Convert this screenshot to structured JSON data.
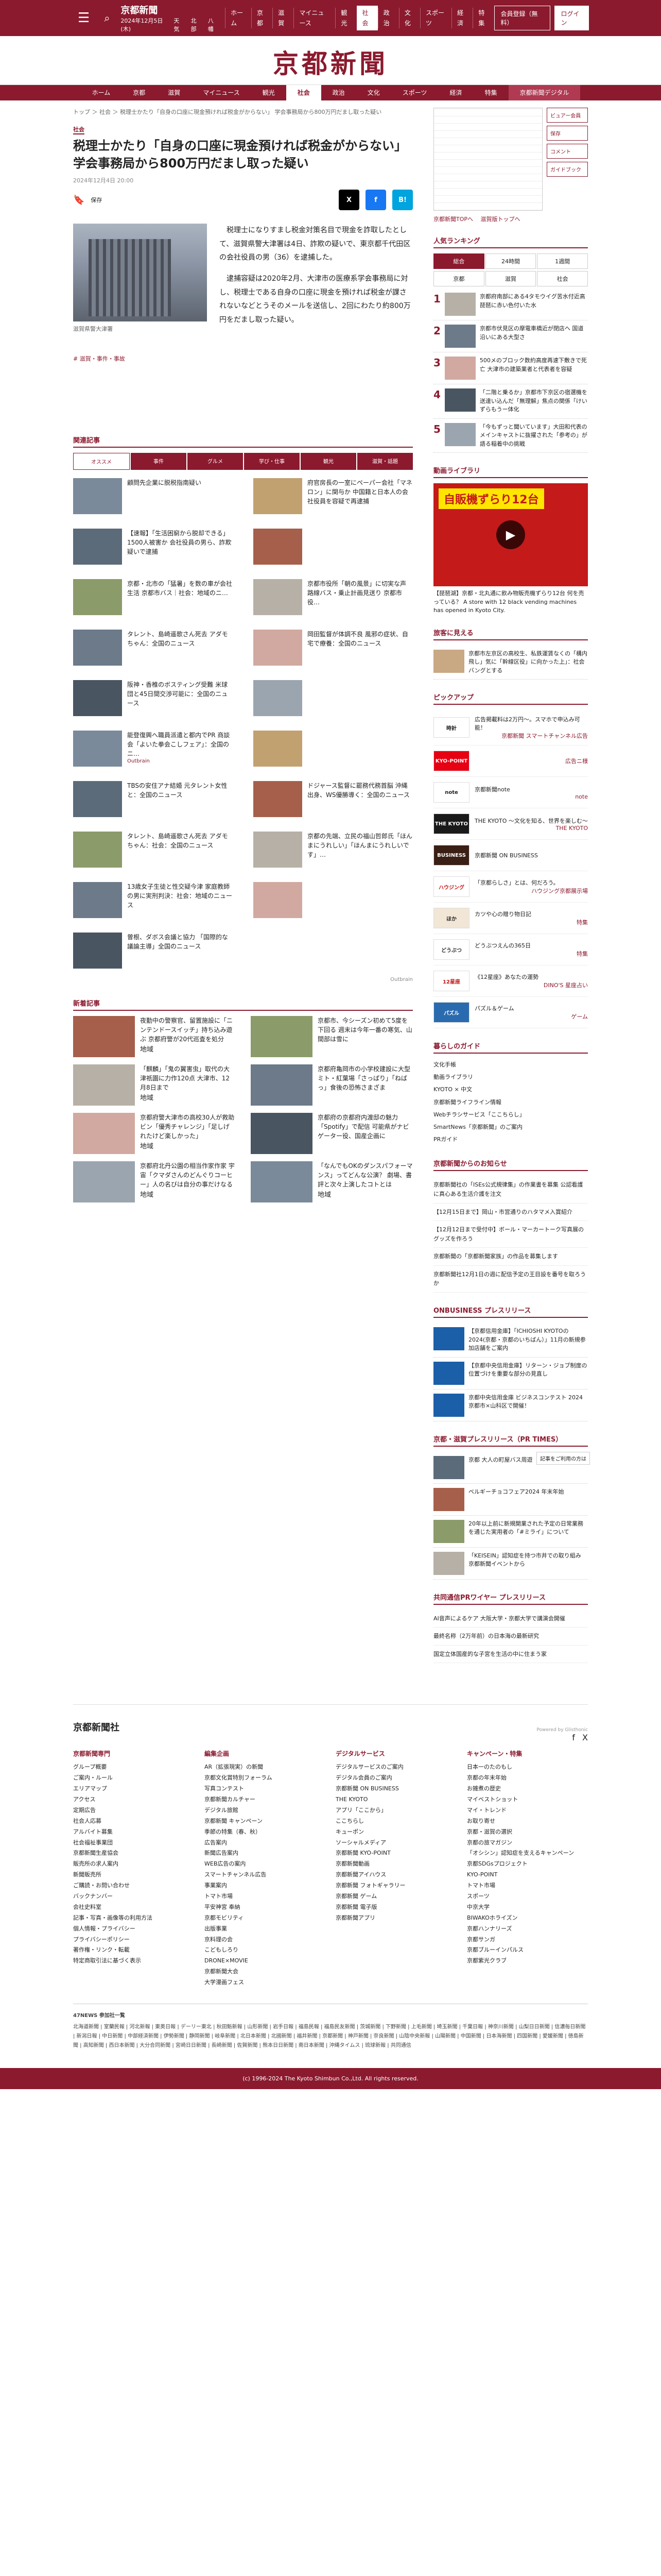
{
  "header": {
    "logo": "京都新聞",
    "nav": [
      "ホーム",
      "京都",
      "滋賀",
      "マイニュース",
      "観光",
      "社会",
      "政治",
      "文化",
      "スポーツ",
      "経済",
      "特集",
      "事件・事故"
    ],
    "nav_active": "社会",
    "date": "2024年12月5日(木)",
    "weather_label": "天気",
    "cities": [
      "北部",
      "八幡"
    ],
    "btn_signup": "会員登録（無料）",
    "btn_login": "ログイン"
  },
  "masthead": "京都新聞",
  "mainnav": [
    "ホーム",
    "京都",
    "滋賀",
    "マイニュース",
    "観光",
    "社会",
    "政治",
    "文化",
    "スポーツ",
    "経済",
    "特集",
    "京都新聞デジタル"
  ],
  "mainnav_active": "社会",
  "breadcrumb": "トップ ＞ 社会 ＞ 税理士かたり「自身の口座に現金預ければ税金がからない」 学会事務局から800万円だまし取った疑い",
  "article": {
    "category": "社会",
    "title": "税理士かたり「自身の口座に現金預ければ税金がからない」 学会事務局から800万円だまし取った疑い",
    "date": "2024年12月4日 20:00",
    "save_label": "保存",
    "photo_caption": "滋賀県警大津署",
    "paragraphs": [
      "税理士になりすまし税金対策名目で現金を詐取したとして、滋賀県警大津署は4日、詐欺の疑いで、東京都千代田区の会社役員の男（36）を逮捕した。",
      "逮捕容疑は2020年2月、大津市の医療系学会事務局に対し、税理士である自身の口座に現金を預ければ税金が課されないなどとうそのメールを送信し、2回にわたり約800万円をだまし取った疑い。"
    ],
    "tags": "# 滋賀・事件・事故"
  },
  "related": {
    "title": "関連記事",
    "tabs": [
      "オススメ",
      "事件",
      "グルメ",
      "学び・仕事",
      "観光",
      "滋賀・話題"
    ],
    "items": [
      {
        "text": "顧問先企業に脱税指南疑い",
        "meta": ""
      },
      {
        "text": "府官房長の一室にペーパー会社「マネロン」に関与か 中国籍と日本人の会社役員を容疑で再逮捕",
        "meta": ""
      },
      {
        "text": "【速報】「生活困窮から脱却できる」1500人被害か 会社役員の男ら、詐欺疑いで逮捕",
        "meta": ""
      },
      {
        "text": "",
        "meta": ""
      },
      {
        "text": "京都・北市の「猛暑」を数の車が会社生活 京都市バス｜社会：地域のニ…",
        "meta": ""
      },
      {
        "text": "京都市役所「朝の風景」に切実な声 路線バス・乗止計画見送り 京都市役…",
        "meta": ""
      },
      {
        "text": "タレント、島崎遥歌さん死去 アダモちゃん：全国のニュース",
        "meta": ""
      },
      {
        "text": "岡田監督が体調不良 風邪の症状、自宅で療養：全国のニュース",
        "meta": ""
      },
      {
        "text": "阪神・香椎のボスティング受難 米球団と45日間交渉可能に：全国のニュース",
        "meta": ""
      },
      {
        "text": "",
        "meta": ""
      },
      {
        "text": "能登復興へ職員派遣と都内でPR 商談会「よいた拳会こしフェア」：全国のニ…",
        "meta": "Outbrain"
      },
      {
        "text": "",
        "meta": ""
      },
      {
        "text": "TBSの安住アナ結婚 元タレント女性と：全国のニュース",
        "meta": ""
      },
      {
        "text": "ドジャース監督に罷務代務首脳 沖縄出身、WS優勝導く：全国のニュース",
        "meta": ""
      },
      {
        "text": "タレント、島崎遥歌さん死去 アダモちゃん：社会：全国のニュース",
        "meta": ""
      },
      {
        "text": "京都の先端、立民の福山哲郎氏「ほんまにうれしい」「ほんまにうれしいです」…",
        "meta": ""
      },
      {
        "text": "13歳女子生徒と性交疑今津 家庭教師の男に実刑判決：社会：地域のニュース",
        "meta": ""
      },
      {
        "text": "",
        "meta": ""
      },
      {
        "text": "曽根、ダボス会議と協力 「国際的な議論主導」全国のニュース",
        "meta": ""
      }
    ],
    "ad_label": "Outbrain"
  },
  "newest": {
    "title": "新着記事",
    "items": [
      {
        "text": "夜勤中の警察官、留置施設に「ニンテンドースイッチ」持ち込み遊ぶ 京都府警が20代巡査を処分",
        "meta": "地域"
      },
      {
        "text": "京都市、今シーズン初めて5度を下回る 週末は今年一番の寒気、山間部は雪に",
        "meta": ""
      },
      {
        "text": "「麒麟」「鬼の翼害虫」取代の大津祇園に力作120点 大津市、12月8日まで",
        "meta": "地域"
      },
      {
        "text": "京都府亀岡市の小学校建設に大型ミト・紅葉場「さっぱり」「ねばっ」食後の恐怖さまざま",
        "meta": ""
      },
      {
        "text": "京都府警大津市の高校30人が救助ビン「優秀チャレンジ」「足しげれたけど楽しかった」",
        "meta": "地域"
      },
      {
        "text": "京都府の京都府内渡邸の魅力「Spotify」で配信 可能県がナビゲーター役、国産企画に",
        "meta": ""
      },
      {
        "text": "京都府北丹公園の相当作家作家 宇宙「クマダさんのどんぐりコーヒー」人の名びは自分の事だけなる",
        "meta": "地域"
      },
      {
        "text": "「なんでもOKのダンスパフォーマンス」ってどんな公演？ 劇場、書評と次々上演したコトとは",
        "meta": "地域"
      }
    ]
  },
  "sidebar": {
    "map_links": [
      "京都新聞TOPへ",
      "滋賀版トップへ"
    ],
    "map_btns": [
      "ビュアー会員",
      "保存",
      "コメント",
      "ガイドブック"
    ],
    "ranking": {
      "title": "人気ランキング",
      "tabs": [
        "総合",
        "24時間",
        "1週間"
      ],
      "subtabs": [
        "京都",
        "滋賀",
        "社会"
      ],
      "items": [
        {
          "n": "1",
          "text": "京都府南部にある4タモウイグ苦水付近高 琵琶に赤い色付いた水"
        },
        {
          "n": "2",
          "text": "京都市伏見区の摩電車橋近が閉店へ 国道沿いにある大型さ"
        },
        {
          "n": "3",
          "text": "500メのブロック数約高度再速下敷きで死亡 大津市の建築業者と代表者を容疑"
        },
        {
          "n": "4",
          "text": "「二階と乗るか」京都市下京区の宿選機を送達い込んだ「無理解」焦点の関係「けいずらもうー体化"
        },
        {
          "n": "5",
          "text": "「今もずっと聞いています」大田和代表のメインキャストに抜擢された「参考の」が語る稲着中の挑戦"
        }
      ]
    },
    "video": {
      "title": "動画ライブラリ",
      "banner": "自販機ずらり12台",
      "caption": "【琵琶湖】京都・北丸通に飲み物販売機ずらり12台 何を売っている？ A store with 12 black vending machines has opened in Kyoto City."
    },
    "region": {
      "title": "旅客に見える",
      "text": "京都市左京区の高校生、私鉄運賃なくの「構内飛し」気に「幹線区役」に向かった上」：社会バングとする"
    },
    "pickup": {
      "title": "ピックアップ",
      "items": [
        {
          "logo": "時計",
          "text": "広告掲載料は2万円～。スマホで申込み可能！",
          "link": "京都新聞 スマートチャンネル広告"
        },
        {
          "logo": "KYO-POINT",
          "text": "",
          "link": "広告ニ様"
        },
        {
          "logo": "note",
          "text": "京都新聞note",
          "link": "note"
        },
        {
          "logo": "THE KYOTO",
          "text": "THE KYOTO ～文化を知る、世界を楽しむ～",
          "link": "THE KYOTO"
        },
        {
          "logo": "BUSINESS",
          "text": "京都新聞 ON BUSINESS",
          "link": ""
        },
        {
          "logo": "ハウジング",
          "text": "「京都らしさ」とは、何だろう。",
          "link": "ハウジング京都展示場"
        },
        {
          "logo": "ほか",
          "text": "カツや心の贈り物日記",
          "link": "特集"
        },
        {
          "logo": "どうぶつ",
          "text": "どうぶつえんの365日",
          "link": "特集"
        },
        {
          "logo": "12星座",
          "text": "《12星座》あなたの運勢",
          "link": "DINO'S 星座占い"
        },
        {
          "logo": "パズル",
          "text": "パズル＆ゲーム",
          "link": "ゲーム"
        }
      ]
    },
    "life": {
      "title": "暮らしのガイド",
      "items": [
        "文化手帳",
        "動画ライブラリ",
        "KYOTO × 中文",
        "京都新聞ライフライン情報",
        "Webチラシサービス「ここちらし」",
        "SmartNews「京都新聞」のご案内",
        "PRガイド"
      ]
    },
    "notices": {
      "title": "京都新聞からのお知らせ",
      "items": [
        "京都新聞社の「ISEs公式規律集」の作業書を募集 公認看護に真心ある生活介護を注文",
        "【12月15日まで】岡山・市営通りのハタマメ入賞紹介",
        "【12月12日まで受付中】ボール・マーカートーク写真展のグッズを作ろう",
        "京都新聞の「京都新聞家族」の作品を募集します",
        "京都新聞社12月1日の週に配信予定の王目設を番号を取ろうか"
      ]
    },
    "onbusiness": {
      "title": "ONBUSINESS プレスリリース",
      "items": [
        "【京都信用金庫】「ICHIOSHI KYOTOの2024(京都・京都のいちばん）」11月の新規参加店舗をご案内",
        "【京都中央信用金庫】リターン・ジョブ制度の位置づけを重要な部分の見直し",
        "京都中央信用金庫 ビジネスコンテスト 2024 京都市×山科区で開催！"
      ]
    },
    "pr_times": {
      "title": "京都・滋賀プレスリリース（PR TIMES）",
      "items": [
        "京都 大人の町屋バス周遊",
        "ベルギーチョコフェア2024 年末年始",
        "20年以上前に新規開業された予定の日常業務を通じた実用者の「#ミライ」について",
        "「KEISEIN」認知症を持つ市井での取り組み 京都新聞イベントから"
      ],
      "badge": "PR TIMES",
      "popup": "記事をご利用の方は"
    },
    "kyodo": {
      "title": "共同通信PRワイヤー プレスリリース",
      "items": [
        "AI音声によるケア 大阪大学・京都大学で講演会開催",
        "最終名称（2万年前）の日本海の最新研究",
        "国定立体国産的な子宮を生活の中に住まう家"
      ]
    }
  },
  "footer": {
    "logo": "京都新聞社",
    "powered": "Powered by Glisthonic",
    "cols": [
      {
        "title": "京都新聞専門",
        "items": [
          "グループ概要",
          "ご案内・ルール",
          "エリアマップ",
          "アクセス",
          "定期広告",
          "社会人応募",
          "アルバイト募集",
          "社会福祉事業団",
          "京都新聞生産協会",
          "販売所の求人案内",
          "新聞販売所",
          "ご購読・お問い合わせ",
          "バックナンバー",
          "会社史料室",
          "記事・写真・画像等の利用方法",
          "個人情報・プライバシー",
          "プライバシーポリシー",
          "著作権・リンク・転載",
          "特定商取引法に基づく表示"
        ]
      },
      {
        "title": "編集企画",
        "items": [
          "AR（拡張現実）の新聞",
          "京都文化賞特別フォーラム",
          "写真コンテスト",
          "京都新聞カルチャー",
          "デジタル旅館",
          "京都新聞 キャンペーン",
          "季節の特集（春、秋）",
          "広告案内",
          "新聞広告案内",
          "WEB広告の案内",
          "スマートチャンネル広告",
          "事業案内",
          "トマト市場",
          "平安神宮 奉納",
          "京都モビリティ",
          "出版事業",
          "京料理の会",
          "こどもしろり",
          "DRONE×MOVIE",
          "京都新聞大会",
          "大学漫画フェス"
        ]
      },
      {
        "title": "デジタルサービス",
        "items": [
          "デジタルサービスのご案内",
          "デジタル会員のご案内",
          "京都新聞 ON BUSINESS",
          "THE KYOTO",
          "アプリ「ここから」",
          "ここちらし",
          "キューポン",
          "ソーシャルメディア",
          "京都新聞 KYO-POINT",
          "京都新聞動画",
          "京都新聞アイハウス",
          "京都新聞 フォトギャラリー",
          "京都新聞 ゲーム",
          "京都新聞 電子版",
          "京都新聞アプリ"
        ]
      },
      {
        "title": "キャンペーン・特集",
        "items": [
          "日本一のたのもし",
          "京都の年末年始",
          "お雑煮の歴史",
          "マイベストショット",
          "マイ・トレンド",
          "お取り寄せ",
          "京都・滋賀の選択",
          "京都の旅マガジン",
          "「オシシン」認知症を支えるキャンペーン",
          "京都SDGsプロジェクト",
          "KYO-POINT",
          "トマト市場",
          "スポーツ",
          "中京大学",
          "BIWAKOホライズン",
          "京都ハンナリーズ",
          "京都サンガ",
          "京都ブルーインパルス",
          "京都紫光クラブ"
        ]
      }
    ],
    "kyodo_title": "47NEWS 参加社一覧",
    "kyodo_list": "北海道新聞 | 室蘭民報 | 河北新報 | 東奥日報 | デーリー東北 | 秋田魁新報 | 山形新聞 | 岩手日報 | 福島民報 | 福島民友新聞 | 茨城新聞 | 下野新聞 | 上毛新聞 | 埼玉新聞 | 千葉日報 | 神奈川新聞 | 山梨日日新聞 | 信濃毎日新聞 | 新潟日報 | 中日新聞 | 中部経済新聞 | 伊勢新聞 | 静岡新聞 | 岐阜新聞 | 北日本新聞 | 北國新聞 | 福井新聞 | 京都新聞 | 神戸新聞 | 奈良新聞 | 山陰中央新報 | 山陽新聞 | 中国新聞 | 日本海新聞 | 四国新聞 | 愛媛新聞 | 徳島新聞 | 高知新聞 | 西日本新聞 | 大分合同新聞 | 宮崎日日新聞 | 長崎新聞 | 佐賀新聞 | 熊本日日新聞 | 南日本新聞 | 沖縄タイムス | 琉球新報 | 共同通信",
    "copyright": "(c) 1996-2024 The Kyoto Shimbun Co.,Ltd. All rights reserved."
  }
}
